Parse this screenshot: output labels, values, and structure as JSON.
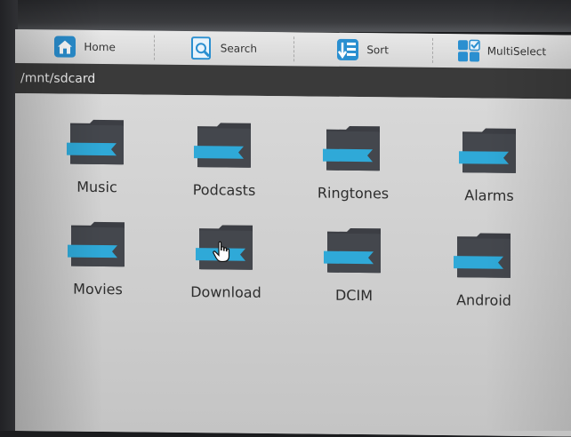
{
  "toolbar": {
    "home": {
      "label": "Home",
      "icon": "home-icon"
    },
    "search": {
      "label": "Search",
      "icon": "search-icon"
    },
    "sort": {
      "label": "Sort",
      "icon": "sort-icon"
    },
    "multiselect": {
      "label": "MultiSelect",
      "icon": "multiselect-icon"
    }
  },
  "path": "/mnt/sdcard",
  "folders": [
    {
      "name": "Music"
    },
    {
      "name": "Podcasts"
    },
    {
      "name": "Ringtones"
    },
    {
      "name": "Alarms"
    },
    {
      "name": "Movies"
    },
    {
      "name": "Download"
    },
    {
      "name": "DCIM"
    },
    {
      "name": "Android"
    }
  ],
  "colors": {
    "folder_body": "#3c3e44",
    "folder_ribbon": "#2fa9d8",
    "toolbar_icon": "#2a8fd0",
    "path_bar": "#3a3a3a"
  }
}
